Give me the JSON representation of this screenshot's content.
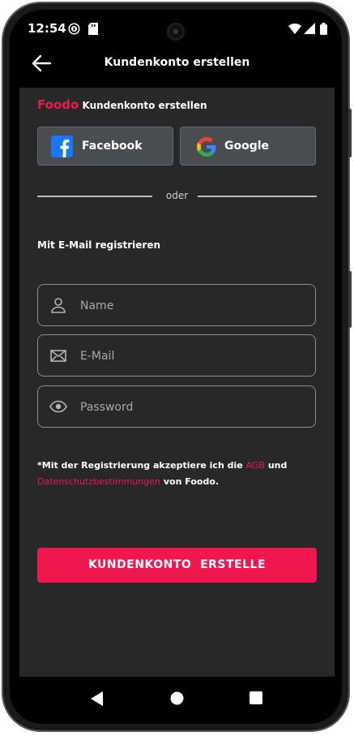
{
  "status_bar": {
    "time": "12:54"
  },
  "app_bar": {
    "title": "Kundenkonto erstellen"
  },
  "heading": {
    "brand": "Foodo",
    "text": "Kundenkonto erstellen"
  },
  "social": {
    "facebook_label": "Facebook",
    "google_label": "Google"
  },
  "divider": {
    "text": "oder"
  },
  "form": {
    "section_title": "Mit E-Mail registrieren",
    "name_placeholder": "Name",
    "email_placeholder": "E-Mail",
    "password_placeholder": "Password"
  },
  "terms": {
    "prefix": "*Mit der Registrierung akzeptiere ich die",
    "agb_link": "AGB",
    "und": "und",
    "privacy_link": "Datenschutzbestimmungen",
    "suffix": "von Foodo."
  },
  "cta": {
    "label": "KUNDENKONTO  ERSTELLE"
  },
  "colors": {
    "accent": "#f0174f",
    "background": "#282828",
    "social_button": "#4a4d50"
  },
  "icons": [
    "back-arrow-icon",
    "user-icon",
    "mail-icon",
    "eye-icon",
    "facebook-icon",
    "google-icon",
    "wifi-icon",
    "signal-icon",
    "battery-icon"
  ]
}
